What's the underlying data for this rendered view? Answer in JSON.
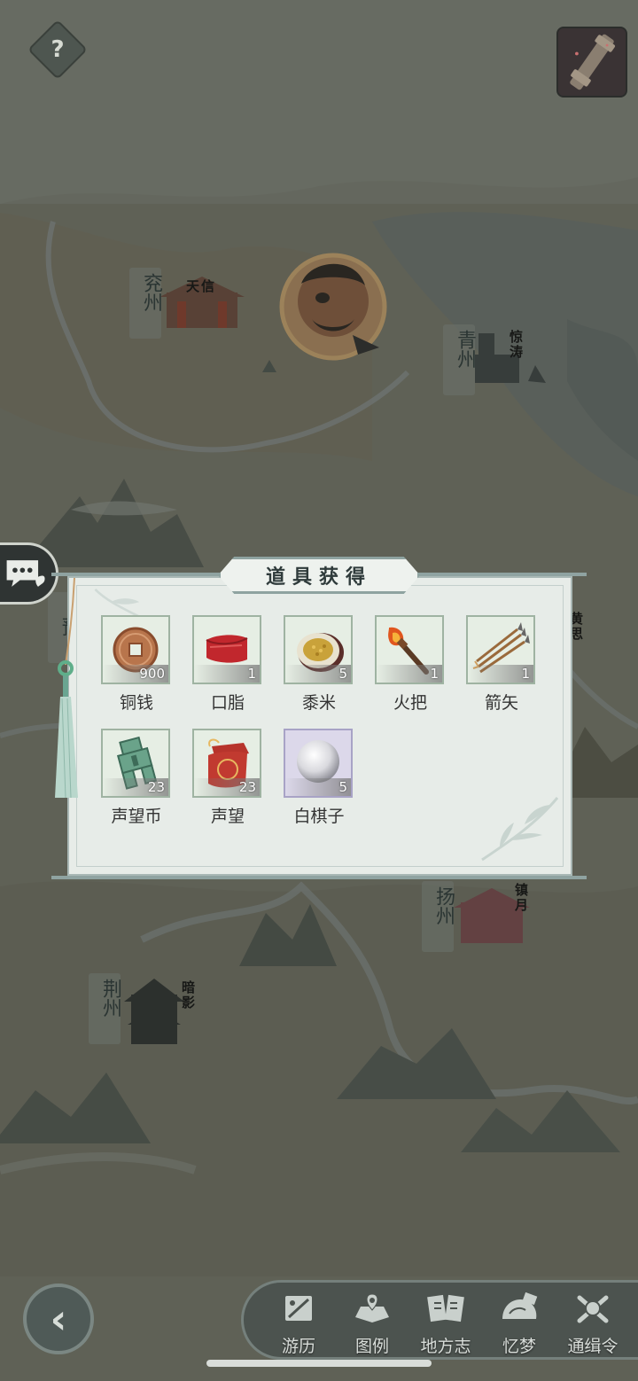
{
  "map": {
    "cities": [
      {
        "name": "兖州",
        "place": "天信"
      },
      {
        "name": "青州",
        "place": "惊涛"
      },
      {
        "name": "扬州",
        "place": "镇月"
      },
      {
        "name": "荆州",
        "place": "暗影"
      }
    ],
    "partial_labels": {
      "left_city_char": "豫",
      "right_place": "黄思"
    }
  },
  "top_bar": {
    "help_label": "?",
    "help_icon": "question-icon",
    "tool_icon": "scroll-tool-icon"
  },
  "chat": {
    "icon": "chat-bubble-icon"
  },
  "reward_panel": {
    "title": "道具获得",
    "items": [
      {
        "name": "铜钱",
        "qty": "900",
        "icon": "copper-coin-icon",
        "rarity": "green"
      },
      {
        "name": "口脂",
        "qty": "1",
        "icon": "rouge-icon",
        "rarity": "green"
      },
      {
        "name": "黍米",
        "qty": "5",
        "icon": "millet-icon",
        "rarity": "green"
      },
      {
        "name": "火把",
        "qty": "1",
        "icon": "torch-icon",
        "rarity": "green"
      },
      {
        "name": "箭矢",
        "qty": "1",
        "icon": "arrows-icon",
        "rarity": "green"
      },
      {
        "name": "声望币",
        "qty": "23",
        "icon": "jade-coin-icon",
        "rarity": "green"
      },
      {
        "name": "声望",
        "qty": "23",
        "icon": "reputation-bag-icon",
        "rarity": "green"
      },
      {
        "name": "白棋子",
        "qty": "5",
        "icon": "white-go-stone-icon",
        "rarity": "purple"
      }
    ]
  },
  "bottom_nav": {
    "back_label": "‹",
    "items": [
      {
        "label": "游历",
        "icon": "travel-icon"
      },
      {
        "label": "图例",
        "icon": "legend-icon"
      },
      {
        "label": "地方志",
        "icon": "gazetteer-icon"
      },
      {
        "label": "忆梦",
        "icon": "dream-icon"
      },
      {
        "label": "通缉令",
        "icon": "wanted-icon"
      }
    ]
  },
  "colors": {
    "panel_bg": "#e7ece8",
    "panel_border": "#8ea3a0",
    "map_tone": "#6f6f60",
    "nav_bg": "#4c534f"
  }
}
